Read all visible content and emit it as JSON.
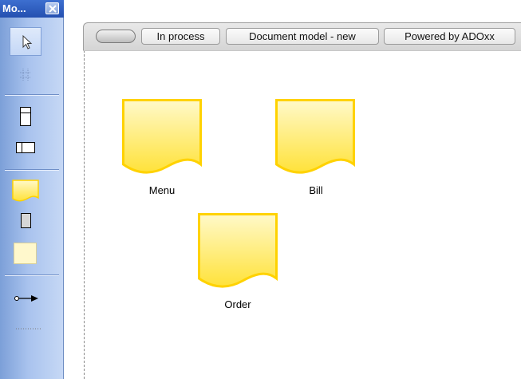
{
  "palette": {
    "title": "Mo...",
    "close_icon": "close-icon",
    "tools": [
      {
        "name": "pointer-tool",
        "icon": "pointer-icon",
        "selected": true
      },
      {
        "name": "grid-tool",
        "icon": "grid-icon",
        "selected": false
      },
      {
        "name": "swimlane-horizontal-tool",
        "icon": "swimlane-horizontal-icon",
        "selected": false
      },
      {
        "name": "swimlane-vertical-tool",
        "icon": "swimlane-vertical-icon",
        "selected": false
      },
      {
        "name": "document-tool",
        "icon": "document-icon",
        "selected": false
      },
      {
        "name": "gray-rectangle-tool",
        "icon": "rectangle-icon",
        "selected": false
      },
      {
        "name": "note-tool",
        "icon": "note-icon",
        "selected": false
      },
      {
        "name": "relation-arrow-tool",
        "icon": "arrow-connector-icon",
        "selected": false
      },
      {
        "name": "dotted-line-tool",
        "icon": "dotted-line-icon",
        "selected": false
      }
    ]
  },
  "mode_bar": {
    "tabs": [
      "In process",
      "Document model - new",
      "Powered by ADOxx"
    ]
  },
  "canvas": {
    "objects": [
      {
        "label": "Menu"
      },
      {
        "label": "Bill"
      },
      {
        "label": "Order"
      }
    ]
  },
  "colors": {
    "document_fill_top": "#fff9c9",
    "document_fill_bottom": "#ffe23a",
    "document_border": "#ffd200",
    "palette_title": "#2a55b5",
    "palette_body": "#a9c3ee"
  }
}
